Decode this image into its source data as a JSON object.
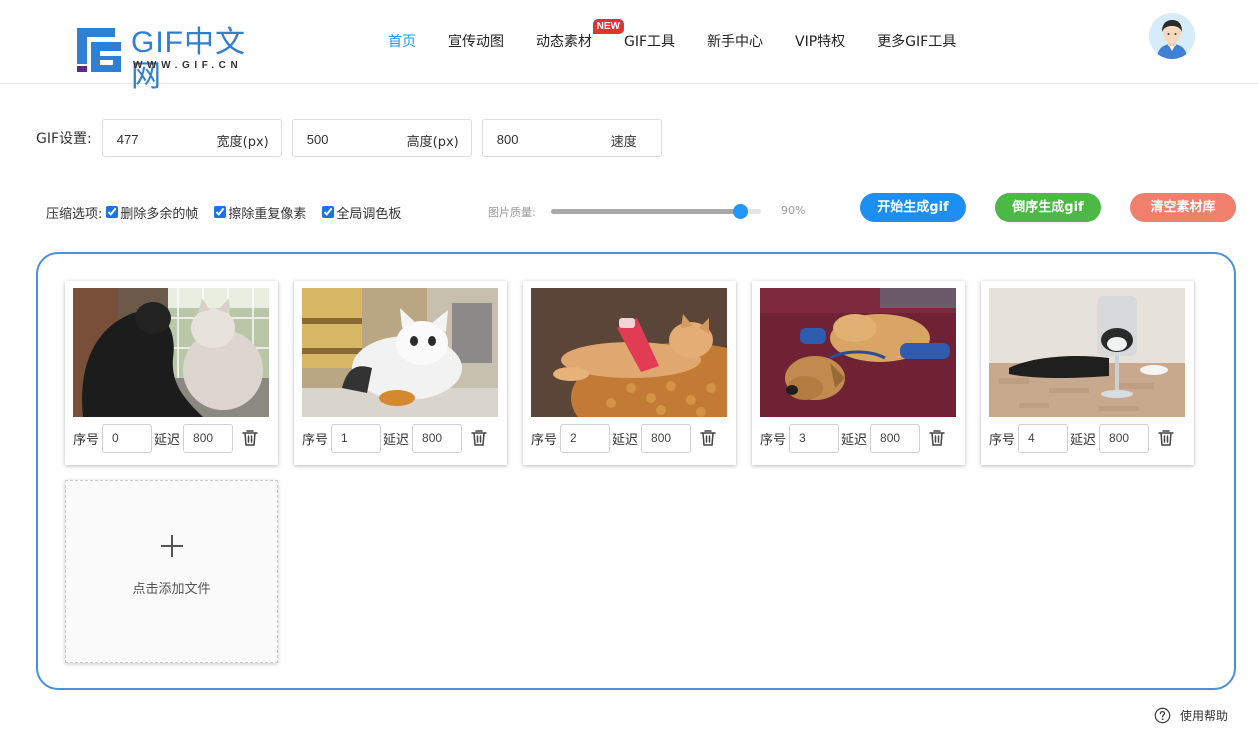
{
  "header": {
    "logo_text": "GIF中文网",
    "logo_sub": "WWW.GIF.CN",
    "nav": [
      {
        "label": "首页",
        "active": true
      },
      {
        "label": "宣传动图",
        "active": false
      },
      {
        "label": "动态素材",
        "active": false,
        "badge": "NEW"
      },
      {
        "label": "GIF工具",
        "active": false
      },
      {
        "label": "新手中心",
        "active": false
      },
      {
        "label": "VIP特权",
        "active": false
      },
      {
        "label": "更多GIF工具",
        "active": false
      }
    ]
  },
  "settings": {
    "label": "GIF设置:",
    "width": {
      "value": "477",
      "unit": "宽度(px)"
    },
    "height": {
      "value": "500",
      "unit": "高度(px)"
    },
    "speed": {
      "value": "800",
      "unit": "速度"
    }
  },
  "compress": {
    "label": "压缩选项:",
    "options": [
      {
        "label": "删除多余的帧",
        "checked": true
      },
      {
        "label": "擦除重复像素",
        "checked": true
      },
      {
        "label": "全局调色板",
        "checked": true
      }
    ]
  },
  "quality": {
    "label": "图片质量:",
    "value": 90,
    "value_text": "90%"
  },
  "buttons": {
    "start": "开始生成gif",
    "reverse": "倒序生成gif",
    "clear": "清空素材库"
  },
  "frames": {
    "seq_label": "序号",
    "delay_label": "延迟",
    "items": [
      {
        "seq": "0",
        "delay": "800"
      },
      {
        "seq": "1",
        "delay": "800"
      },
      {
        "seq": "2",
        "delay": "800"
      },
      {
        "seq": "3",
        "delay": "800"
      },
      {
        "seq": "4",
        "delay": "800"
      }
    ],
    "add_label": "点击添加文件"
  },
  "help": {
    "label": "使用帮助"
  },
  "colors": {
    "accent": "#2196f3",
    "border_blue": "#4a90e2",
    "btn_start": "#1c8ff0",
    "btn_reverse": "#4cb845",
    "btn_clear": "#f07f6e",
    "badge": "#e4322f"
  }
}
